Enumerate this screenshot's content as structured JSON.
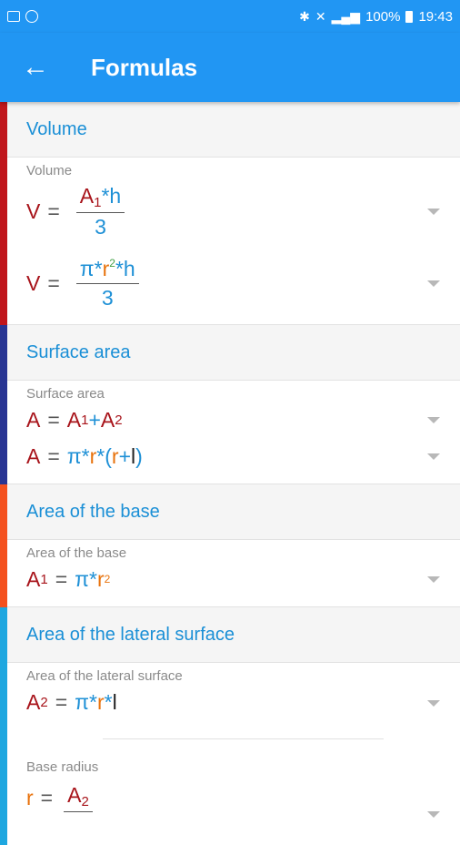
{
  "status_bar": {
    "battery": "100%",
    "time": "19:43"
  },
  "app_bar": {
    "title": "Formulas"
  },
  "sections": {
    "volume": {
      "header": "Volume",
      "label": "Volume",
      "color": "#c0161c"
    },
    "surface": {
      "header": "Surface area",
      "label": "Surface area",
      "color": "#283593"
    },
    "base": {
      "header": "Area of the base",
      "label": "Area of the base",
      "color": "#f4511e"
    },
    "lateral": {
      "header": "Area of the lateral surface",
      "label": "Area of the lateral surface",
      "label2": "Base radius",
      "color": "#1ea7e0"
    }
  },
  "symbols": {
    "V": "V",
    "A": "A",
    "h": "h",
    "r": "r",
    "l": "l",
    "pi": "π",
    "one": "1",
    "two": "2",
    "three": "3",
    "eq": "=",
    "mul": "*",
    "plus": "+",
    "lp": "(",
    "rp": ")"
  }
}
